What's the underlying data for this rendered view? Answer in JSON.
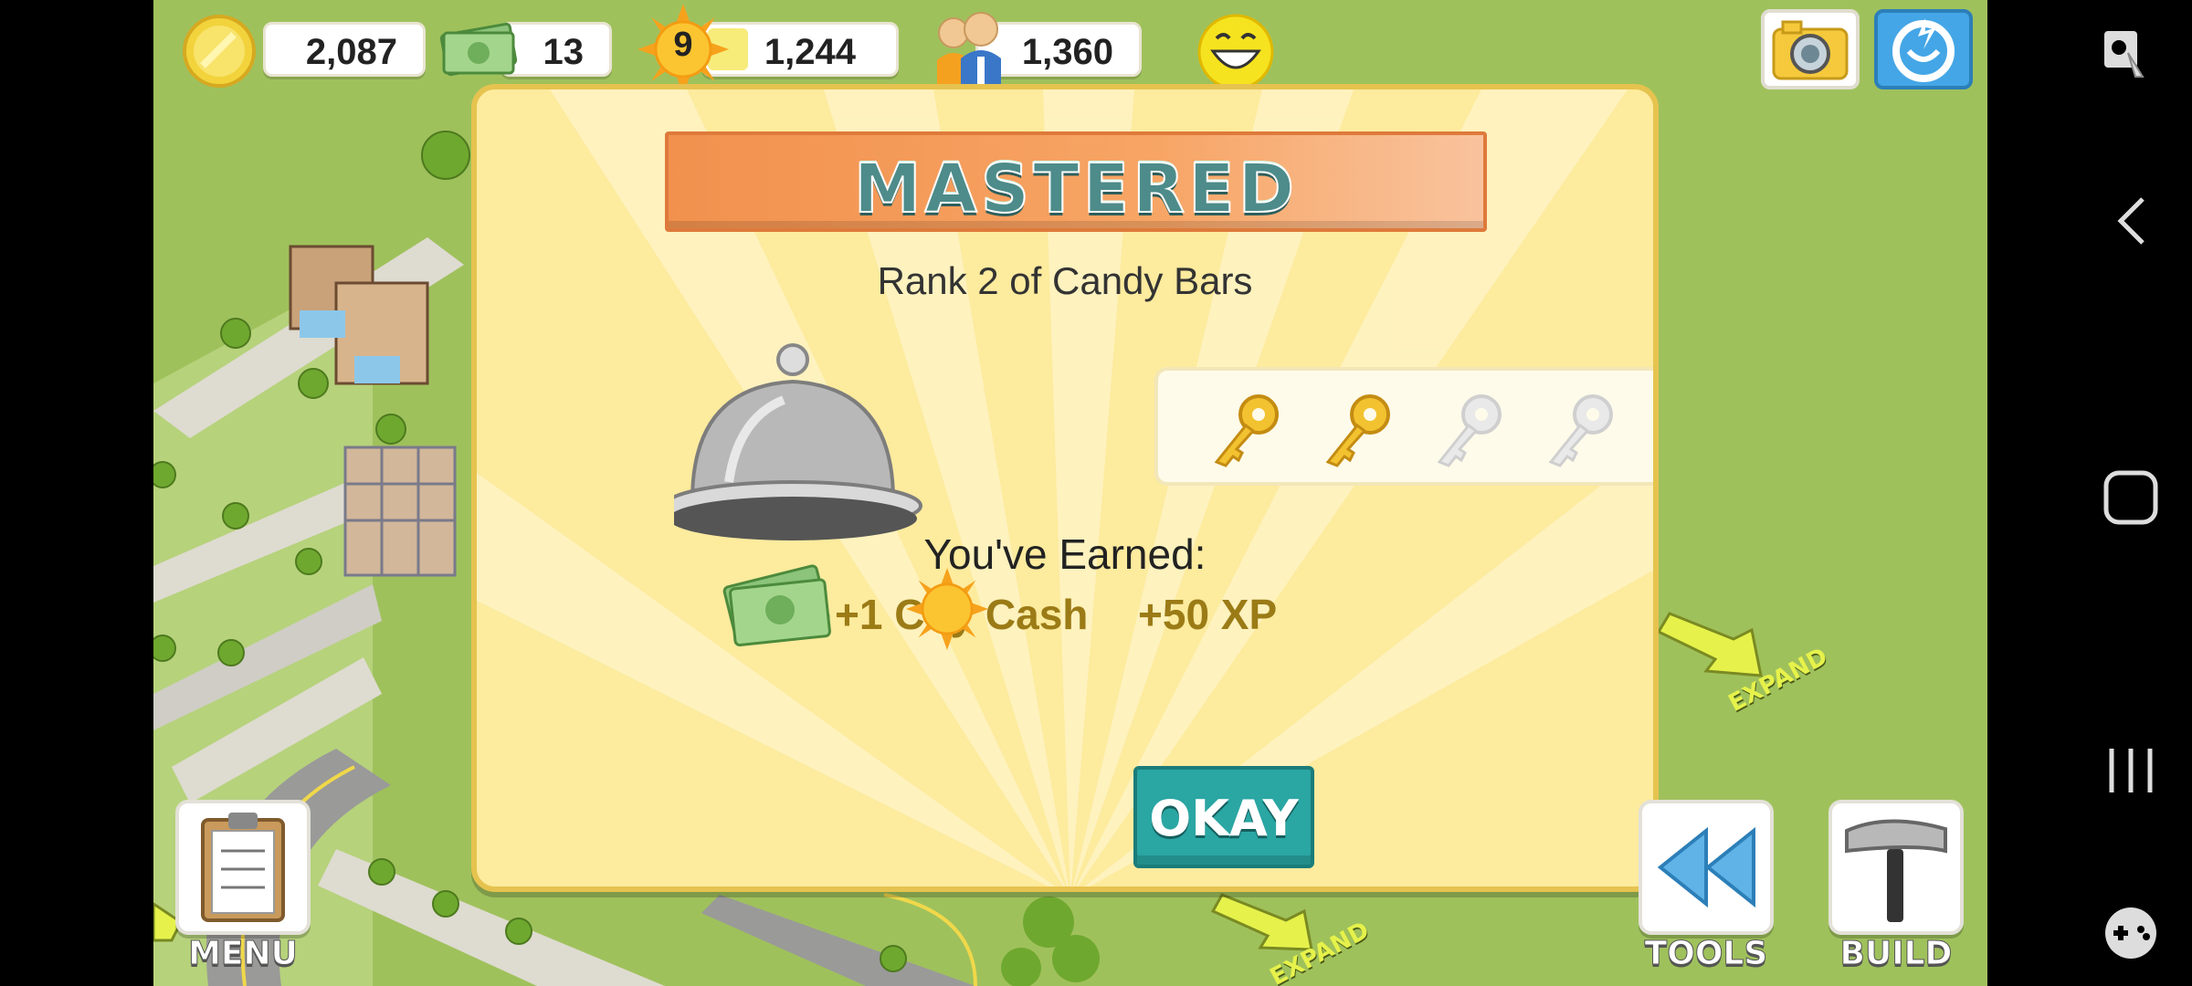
{
  "hud": {
    "coins": "2,087",
    "city_cash": "13",
    "level": "9",
    "xp": "1,244",
    "population": "1,360"
  },
  "modal": {
    "banner_title": "MASTERED",
    "rank_text": "Rank 2 of Candy Bars",
    "keys": {
      "earned": 2,
      "total": 4
    },
    "earned_heading": "You've Earned:",
    "reward_cash": "+1 City Cash",
    "reward_xp": "+50 XP",
    "okay_label": "OKAY"
  },
  "bottom_bar": {
    "menu_label": "MENU",
    "tools_label": "TOOLS",
    "build_label": "BUILD"
  },
  "world": {
    "expand_label": "EXPAND"
  },
  "icons": {
    "coin": "coin-icon",
    "cash": "cash-icon",
    "xp": "sun-icon",
    "population": "people-icon",
    "happiness": "smiley-icon",
    "camera": "camera-icon",
    "social": "social-icon",
    "reward": "cloche-icon",
    "key": "key-icon",
    "menu": "clipboard-icon",
    "tools": "rewind-icon",
    "build": "hammer-icon"
  },
  "colors": {
    "modal_bg": "#fdeb9e",
    "banner": "#f2914e",
    "okay_button": "#2aa6a3",
    "grass": "#9fc15c"
  }
}
